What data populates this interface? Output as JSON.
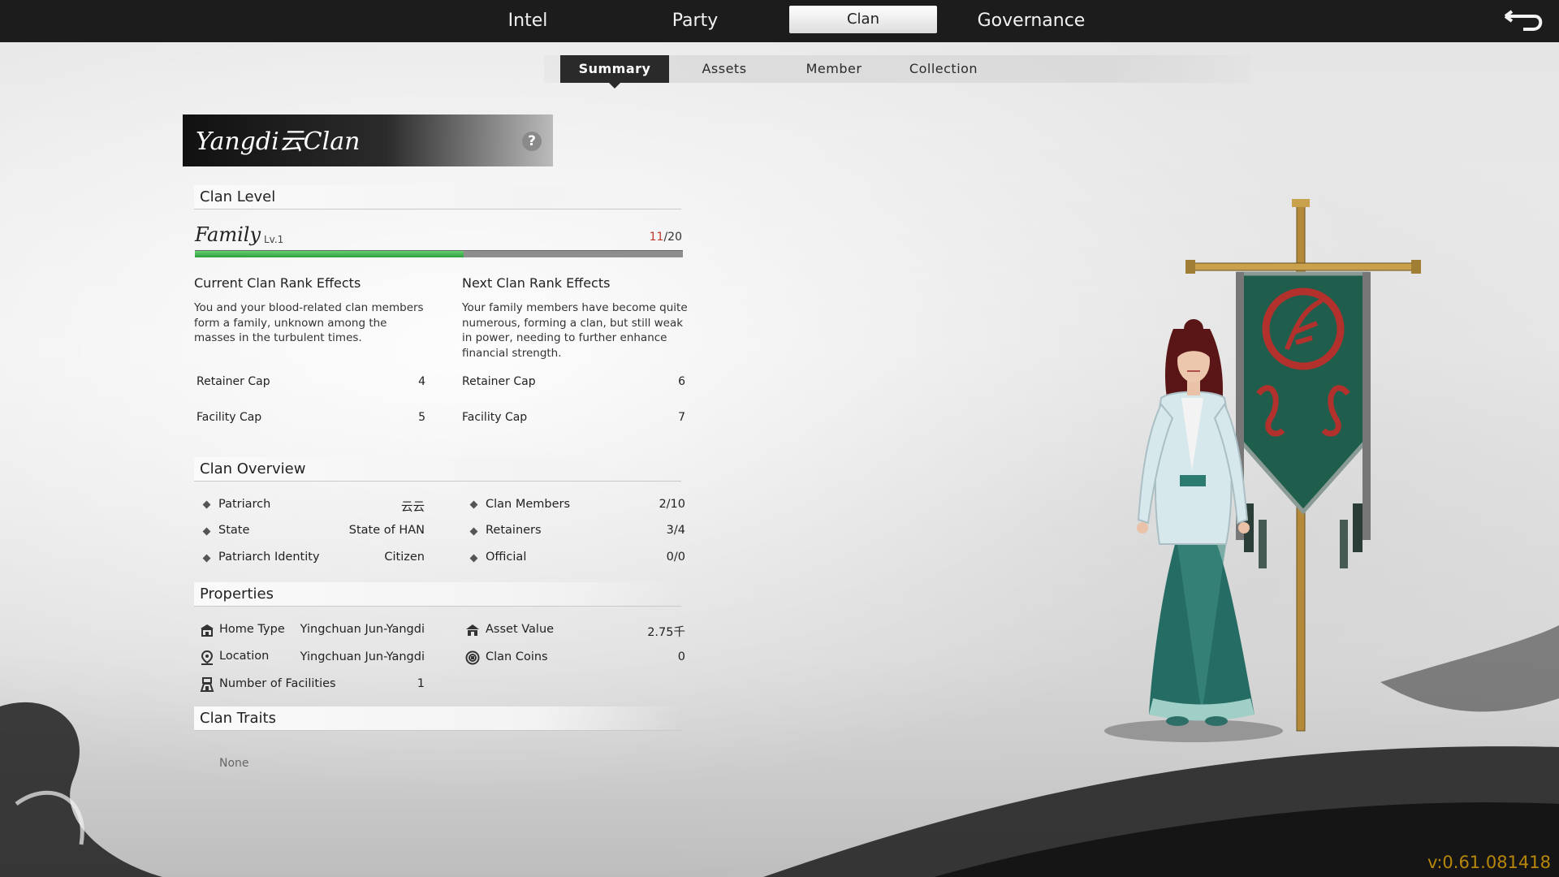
{
  "top_nav": {
    "tabs": [
      {
        "label": "Intel"
      },
      {
        "label": "Party"
      },
      {
        "label": "Clan",
        "active": true
      },
      {
        "label": "Governance"
      }
    ]
  },
  "sub_nav": {
    "tabs": [
      {
        "label": "Summary",
        "active": true
      },
      {
        "label": "Assets"
      },
      {
        "label": "Member"
      },
      {
        "label": "Collection"
      }
    ]
  },
  "clan": {
    "name": "Yangdi云Clan"
  },
  "clan_level": {
    "heading": "Clan Level",
    "rank": "Family",
    "level": "Lv.1",
    "xp_current": "11",
    "xp_max": "/20",
    "xp_fraction": 0.55
  },
  "effects": {
    "current": {
      "heading": "Current Clan Rank Effects",
      "description": "You and your blood-related clan members form a family, unknown among the masses in the turbulent times.",
      "retainer_cap_label": "Retainer Cap",
      "retainer_cap_value": "4",
      "facility_cap_label": "Facility Cap",
      "facility_cap_value": "5"
    },
    "next": {
      "heading": "Next Clan Rank Effects",
      "description": "Your family members have become quite numerous, forming a clan, but still weak in power, needing to further enhance financial strength.",
      "retainer_cap_label": "Retainer Cap",
      "retainer_cap_value": "6",
      "facility_cap_label": "Facility Cap",
      "facility_cap_value": "7"
    }
  },
  "overview": {
    "heading": "Clan Overview",
    "left": [
      {
        "label": "Patriarch",
        "value": "云云"
      },
      {
        "label": "State",
        "value": "State of HAN"
      },
      {
        "label": "Patriarch Identity",
        "value": "Citizen"
      }
    ],
    "right": [
      {
        "label": "Clan Members",
        "value": "2/10"
      },
      {
        "label": "Retainers",
        "value": "3/4"
      },
      {
        "label": "Official",
        "value": "0/0"
      }
    ]
  },
  "properties": {
    "heading": "Properties",
    "left": [
      {
        "label": "Home Type",
        "value": "Yingchuan Jun-Yangdi",
        "icon": "house-icon"
      },
      {
        "label": "Location",
        "value": "Yingchuan Jun-Yangdi",
        "icon": "location-pin-icon"
      },
      {
        "label": "Number of Facilities",
        "value": "1",
        "icon": "facility-icon"
      }
    ],
    "right": [
      {
        "label": "Asset Value",
        "value": "2.75千",
        "icon": "asset-house-icon"
      },
      {
        "label": "Clan Coins",
        "value": "0",
        "icon": "coin-icon"
      }
    ]
  },
  "traits": {
    "heading": "Clan Traits",
    "value": "None"
  },
  "version": "v:0.61.081418",
  "colors": {
    "top_bar": "#1c1c1c",
    "xp_fill": "#3fb34f",
    "xp_current": "#c0392b",
    "banner": "#1f5e4c",
    "banner_emblem": "#b3312c",
    "version_text": "#b8860b"
  }
}
